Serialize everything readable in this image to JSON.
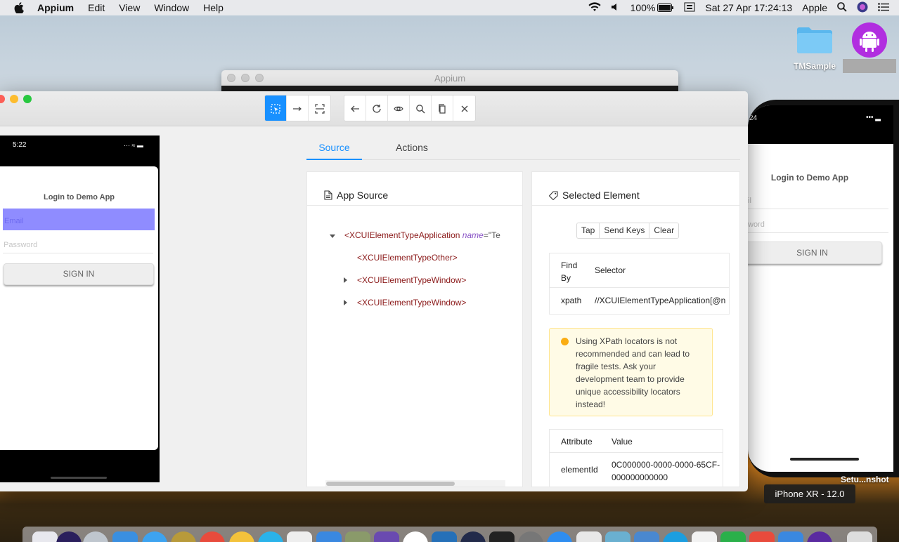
{
  "menubar": {
    "app": "Appium",
    "items": [
      "Edit",
      "View",
      "Window",
      "Help"
    ],
    "battery": "100%",
    "datetime": "Sat 27 Apr  17:24:13",
    "user": "Apple"
  },
  "desktop": {
    "folder_label": "TMSample",
    "screenshot_label": "Setu...nshot",
    "simulator_badge": "iPhone XR - 12.0"
  },
  "background_window": {
    "title": "Appium"
  },
  "device": {
    "time": "5:22",
    "title": "Login to Demo App",
    "email_placeholder": "Email",
    "password_placeholder": "Password",
    "signin": "SIGN IN"
  },
  "simulator": {
    "time": "24",
    "title": "Login to Demo App",
    "email_placeholder": "il",
    "password_placeholder": "word",
    "signin": "SIGN IN"
  },
  "tabs": {
    "source": "Source",
    "actions": "Actions"
  },
  "app_source": {
    "title": "App Source",
    "root_tag": "XCUIElementTypeApplication",
    "root_attr": "name",
    "root_val": "\"Te",
    "children": [
      "XCUIElementTypeOther",
      "XCUIElementTypeWindow",
      "XCUIElementTypeWindow"
    ]
  },
  "selected_element": {
    "title": "Selected Element",
    "buttons": [
      "Tap",
      "Send Keys",
      "Clear"
    ],
    "find_header": {
      "by": "Find By",
      "selector": "Selector"
    },
    "find_row": {
      "by": "xpath",
      "selector": "//XCUIElementTypeApplication[@n"
    },
    "warning": "Using XPath locators is not recommended and can lead to fragile tests. Ask your development team to provide unique accessibility locators instead!",
    "attr_header": {
      "attr": "Attribute",
      "value": "Value"
    },
    "attr_row": {
      "attr": "elementId",
      "value": "0C000000-0000-0000-65CF-000000000000"
    }
  },
  "colors": {
    "accent": "#1890ff",
    "warning_bg": "#fffbe6",
    "warning_border": "#ffe58f",
    "highlight": "#8f8cff"
  }
}
